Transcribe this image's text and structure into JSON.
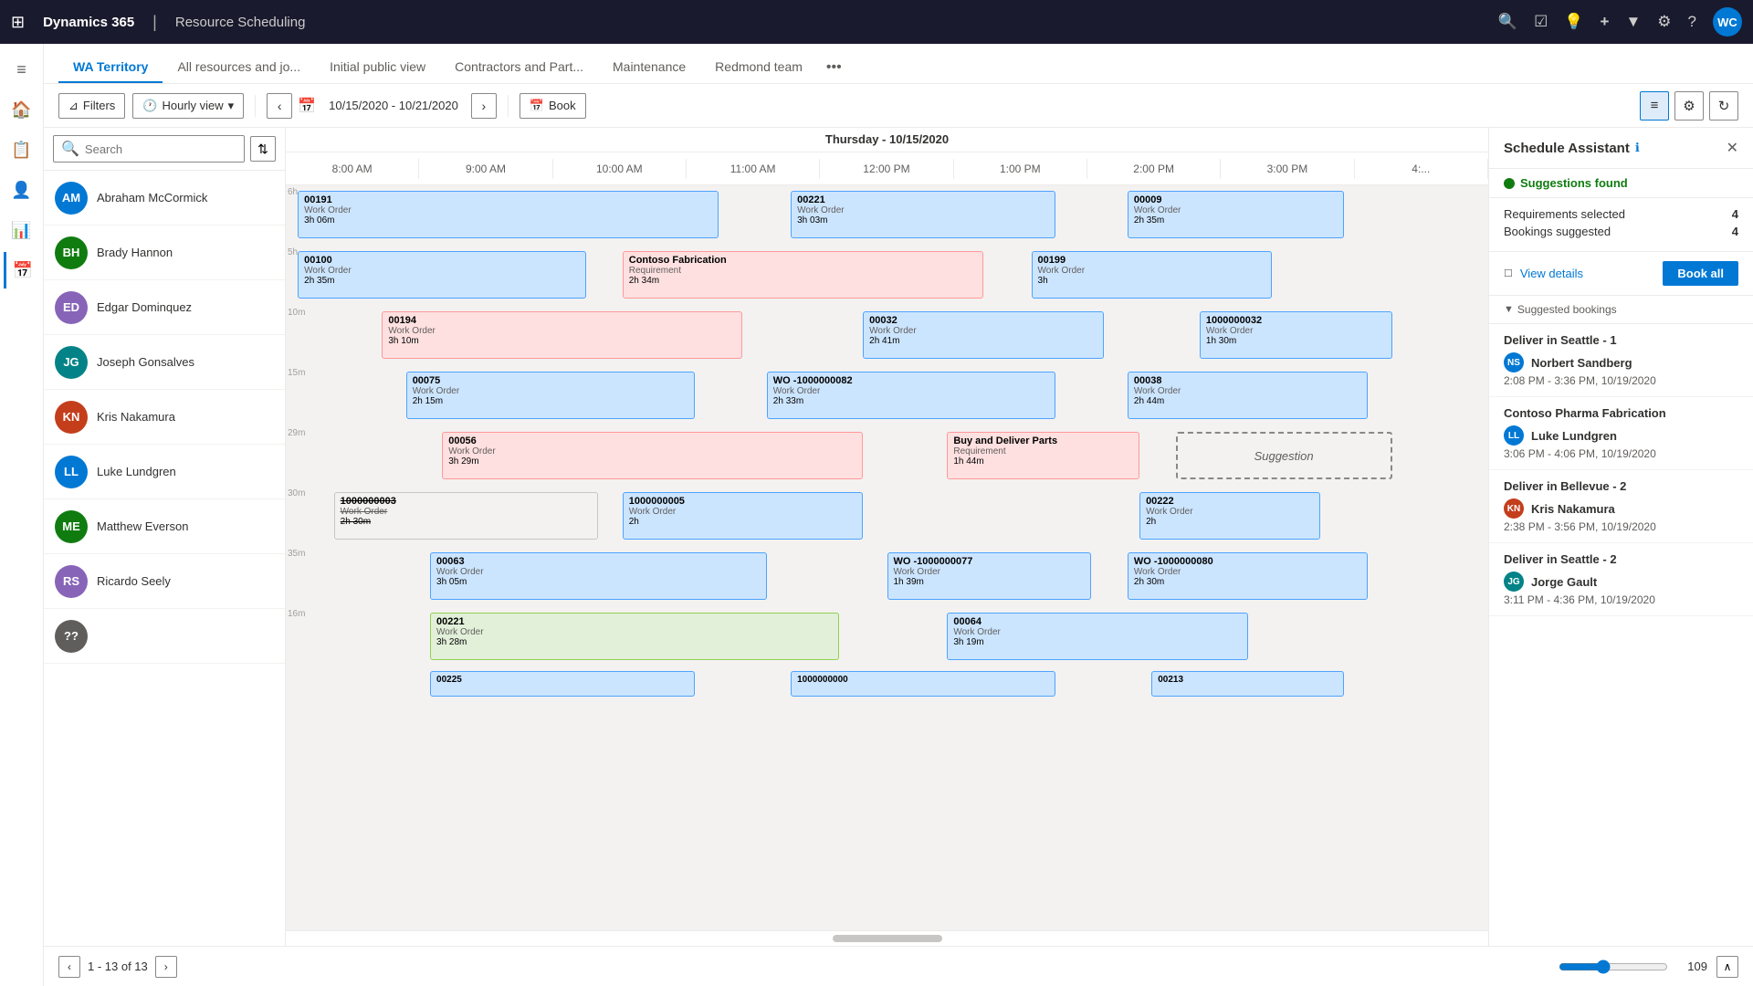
{
  "topNav": {
    "appGridIcon": "⊞",
    "appTitle": "Dynamics 365",
    "separator": "|",
    "moduleName": "Resource Scheduling",
    "icons": [
      "🔍",
      "☑",
      "💡",
      "+",
      "▼",
      "⚙",
      "?"
    ],
    "userInitials": "WC"
  },
  "tabs": [
    {
      "label": "WA Territory",
      "active": true
    },
    {
      "label": "All resources and jo...",
      "active": false
    },
    {
      "label": "Initial public view",
      "active": false
    },
    {
      "label": "Contractors and Part...",
      "active": false
    },
    {
      "label": "Maintenance",
      "active": false
    },
    {
      "label": "Redmond team",
      "active": false
    }
  ],
  "toolbar": {
    "filterLabel": "Filters",
    "viewLabel": "Hourly view",
    "dateRange": "10/15/2020 - 10/21/2020",
    "bookLabel": "Book",
    "chevron": "▾"
  },
  "search": {
    "placeholder": "Search"
  },
  "timelineHeader": {
    "dayLabel": "Thursday - 10/15/2020",
    "times": [
      "8:00 AM",
      "9:00 AM",
      "10:00 AM",
      "11:00 AM",
      "12:00 PM",
      "1:00 PM",
      "2:00 PM",
      "3:00 PM",
      "4:..."
    ]
  },
  "resources": [
    {
      "name": "Abraham McCormick",
      "initials": "AM",
      "color": "#0078d4"
    },
    {
      "name": "Brady Hannon",
      "initials": "BH",
      "color": "#107c10"
    },
    {
      "name": "Edgar Dominquez",
      "initials": "ED",
      "color": "#8764b8"
    },
    {
      "name": "Joseph Gonsalves",
      "initials": "JG",
      "color": "#038387"
    },
    {
      "name": "Kris Nakamura",
      "initials": "KN",
      "color": "#c43e1c"
    },
    {
      "name": "Luke Lundgren",
      "initials": "LL",
      "color": "#0078d4"
    },
    {
      "name": "Matthew Everson",
      "initials": "ME",
      "color": "#107c10"
    },
    {
      "name": "Ricardo Seely",
      "initials": "RS",
      "color": "#8764b8"
    }
  ],
  "bookings": {
    "row0": [
      {
        "id": "00191",
        "type": "Work Order",
        "duration": "3h 06m",
        "style": "blue",
        "left": "0%",
        "width": "38%"
      },
      {
        "id": "00221",
        "type": "Work Order",
        "duration": "3h 03m",
        "style": "blue",
        "left": "45%",
        "width": "25%"
      },
      {
        "id": "00009",
        "type": "Work Order",
        "duration": "2h 35m",
        "style": "blue",
        "left": "73%",
        "width": "18%"
      }
    ],
    "row1": [
      {
        "id": "00100",
        "type": "Work Order",
        "duration": "2h 35m",
        "style": "blue",
        "left": "0%",
        "width": "27%"
      },
      {
        "id": "Contoso Fabrication",
        "type": "Requirement",
        "duration": "2h 34m",
        "style": "pink",
        "left": "30%",
        "width": "33%"
      },
      {
        "id": "00199",
        "type": "Work Order",
        "duration": "3h",
        "style": "blue",
        "left": "65%",
        "width": "20%"
      }
    ],
    "row2": [
      {
        "id": "00194",
        "type": "Work Order",
        "duration": "3h 10m",
        "style": "pink",
        "left": "7%",
        "width": "32%"
      },
      {
        "id": "00032",
        "type": "Work Order",
        "duration": "2h 41m",
        "style": "blue",
        "left": "50%",
        "width": "22%"
      },
      {
        "id": "1000000032",
        "type": "Work Order",
        "duration": "1h 30m",
        "style": "blue",
        "left": "79%",
        "width": "15%"
      }
    ],
    "row3": [
      {
        "id": "00075",
        "type": "Work Order",
        "duration": "2h 15m",
        "style": "blue",
        "left": "10%",
        "width": "25%"
      },
      {
        "id": "WO -1000000082",
        "type": "Work Order",
        "duration": "2h 33m",
        "style": "blue",
        "left": "41%",
        "width": "25%"
      },
      {
        "id": "00038",
        "type": "Work Order",
        "duration": "2h 44m",
        "style": "blue",
        "left": "72%",
        "width": "20%"
      }
    ],
    "row4": [
      {
        "id": "00056",
        "type": "Work Order",
        "duration": "3h 29m",
        "style": "pink",
        "left": "14%",
        "width": "38%"
      },
      {
        "id": "Buy and Deliver Parts",
        "type": "Requirement",
        "duration": "1h 44m",
        "style": "pink",
        "left": "58%",
        "width": "16%"
      },
      {
        "id": "Suggestion",
        "type": "suggestion",
        "duration": "",
        "style": "suggestion",
        "left": "76%",
        "width": "18%"
      }
    ],
    "row5": [
      {
        "id": "1000000003",
        "type": "Work Order",
        "duration": "2h 30m",
        "style": "gray",
        "left": "5%",
        "width": "22%"
      },
      {
        "id": "1000000005",
        "type": "Work Order",
        "duration": "2h",
        "style": "blue",
        "left": "30%",
        "width": "20%"
      },
      {
        "id": "00222",
        "type": "Work Order",
        "duration": "2h",
        "style": "blue",
        "left": "73%",
        "width": "15%"
      }
    ],
    "row6": [
      {
        "id": "00063",
        "type": "Work Order",
        "duration": "3h 05m",
        "style": "blue",
        "left": "14%",
        "width": "30%"
      },
      {
        "id": "WO -1000000077",
        "type": "Work Order",
        "duration": "1h 39m",
        "style": "blue",
        "left": "51%",
        "width": "18%"
      },
      {
        "id": "WO -1000000080",
        "type": "Work Order",
        "duration": "2h 30m",
        "style": "blue",
        "left": "72%",
        "width": "20%"
      }
    ],
    "row7": [
      {
        "id": "00221",
        "type": "Work Order",
        "duration": "3h 28m",
        "style": "green",
        "left": "14%",
        "width": "35%"
      },
      {
        "id": "00064",
        "type": "Work Order",
        "duration": "3h 19m",
        "style": "blue",
        "left": "57%",
        "width": "25%"
      }
    ]
  },
  "scheduleAssistant": {
    "title": "Schedule Assistant",
    "closeIcon": "✕",
    "infoIcon": "ℹ",
    "status": "Suggestions found",
    "requirementsSelected": 4,
    "bookingsSuggested": 4,
    "viewDetailsLabel": "View details",
    "bookAllLabel": "Book all",
    "suggestedBookingsHeader": "Suggested bookings",
    "suggestions": [
      {
        "title": "Deliver in Seattle - 1",
        "personName": "Norbert Sandberg",
        "personInitials": "NS",
        "personColor": "#0078d4",
        "time": "2:08 PM - 3:36 PM, 10/19/2020"
      },
      {
        "title": "Contoso Pharma Fabrication",
        "personName": "Luke Lundgren",
        "personInitials": "LL",
        "personColor": "#0078d4",
        "time": "3:06 PM - 4:06 PM, 10/19/2020"
      },
      {
        "title": "Deliver in Bellevue - 2",
        "personName": "Kris Nakamura",
        "personInitials": "KN",
        "personColor": "#c43e1c",
        "time": "2:38 PM - 3:56 PM, 10/19/2020"
      },
      {
        "title": "Deliver in Seattle - 2",
        "personName": "Jorge Gault",
        "personInitials": "JG",
        "personColor": "#038387",
        "time": "3:11 PM - 4:36 PM, 10/19/2020"
      }
    ]
  },
  "pagination": {
    "current": "1 - 13 of 13"
  },
  "zoom": {
    "value": 109
  },
  "sidebarIcons": [
    "≡",
    "🏠",
    "📋",
    "👤",
    "📊",
    "📅"
  ]
}
